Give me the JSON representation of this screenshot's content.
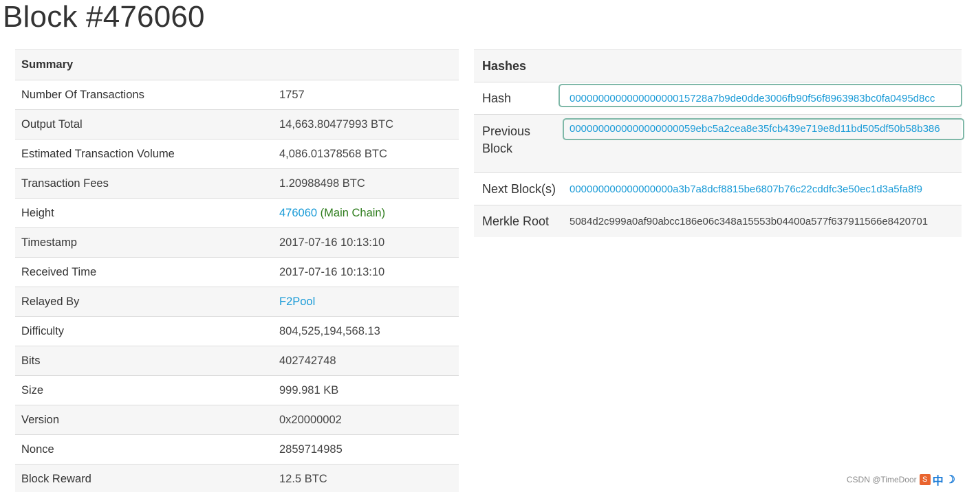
{
  "page": {
    "title": "Block #476060"
  },
  "summary": {
    "header": "Summary",
    "rows": [
      {
        "label": "Number Of Transactions",
        "value": "1757"
      },
      {
        "label": "Output Total",
        "value": "14,663.80477993 BTC"
      },
      {
        "label": "Estimated Transaction Volume",
        "value": "4,086.01378568 BTC"
      },
      {
        "label": "Transaction Fees",
        "value": "1.20988498 BTC"
      },
      {
        "label": "Height",
        "value": "476060",
        "suffix": "(Main Chain)"
      },
      {
        "label": "Timestamp",
        "value": "2017-07-16 10:13:10"
      },
      {
        "label": "Received Time",
        "value": "2017-07-16 10:13:10"
      },
      {
        "label": "Relayed By",
        "value": "F2Pool"
      },
      {
        "label": "Difficulty",
        "value": "804,525,194,568.13"
      },
      {
        "label": "Bits",
        "value": "402742748"
      },
      {
        "label": "Size",
        "value": "999.981 KB"
      },
      {
        "label": "Version",
        "value": "0x20000002"
      },
      {
        "label": "Nonce",
        "value": "2859714985"
      },
      {
        "label": "Block Reward",
        "value": "12.5 BTC"
      }
    ]
  },
  "hashes": {
    "header": "Hashes",
    "hash": {
      "label": "Hash",
      "value": "000000000000000000015728a7b9de0dde3006fb90f56f8963983bc0fa0495d8cc"
    },
    "previous_block": {
      "label": "Previous Block",
      "value": "0000000000000000000059ebc5a2cea8e35fcb439e719e8d11bd505df50b58b386"
    },
    "next_blocks": {
      "label": "Next Block(s)",
      "value": "000000000000000000a3b7a8dcf8815be6807b76c22cddfc3e50ec1d3a5fa8f9"
    },
    "merkle_root": {
      "label": "Merkle Root",
      "value": "5084d2c999a0af90abcc186e06c348a15553b04400a577f637911566e8420701"
    }
  },
  "watermark": {
    "text": "CSDN @TimeDoor"
  },
  "colors": {
    "link": "#1a9bd7",
    "main_chain": "#2e7d1d",
    "highlight_box": "#7fb8a8",
    "row_stripe": "#f6f6f6"
  }
}
